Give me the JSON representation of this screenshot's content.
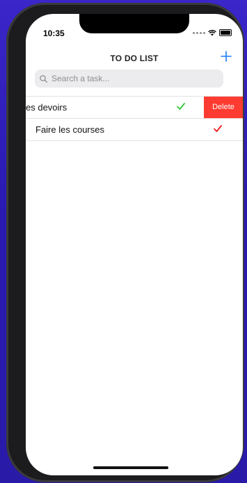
{
  "status_bar": {
    "time": "10:35"
  },
  "nav": {
    "title": "TO DO LIST"
  },
  "search": {
    "placeholder": "Search a task..."
  },
  "tasks": [
    {
      "label": "es devoirs",
      "check_color": "#33c633",
      "swiped": true,
      "delete_label": "Delete"
    },
    {
      "label": "Faire les courses",
      "check_color": "#f01c1c",
      "swiped": false
    }
  ],
  "colors": {
    "accent": "#1a7cf5",
    "delete": "#fe3b30",
    "backdrop": "#3a26c9"
  }
}
